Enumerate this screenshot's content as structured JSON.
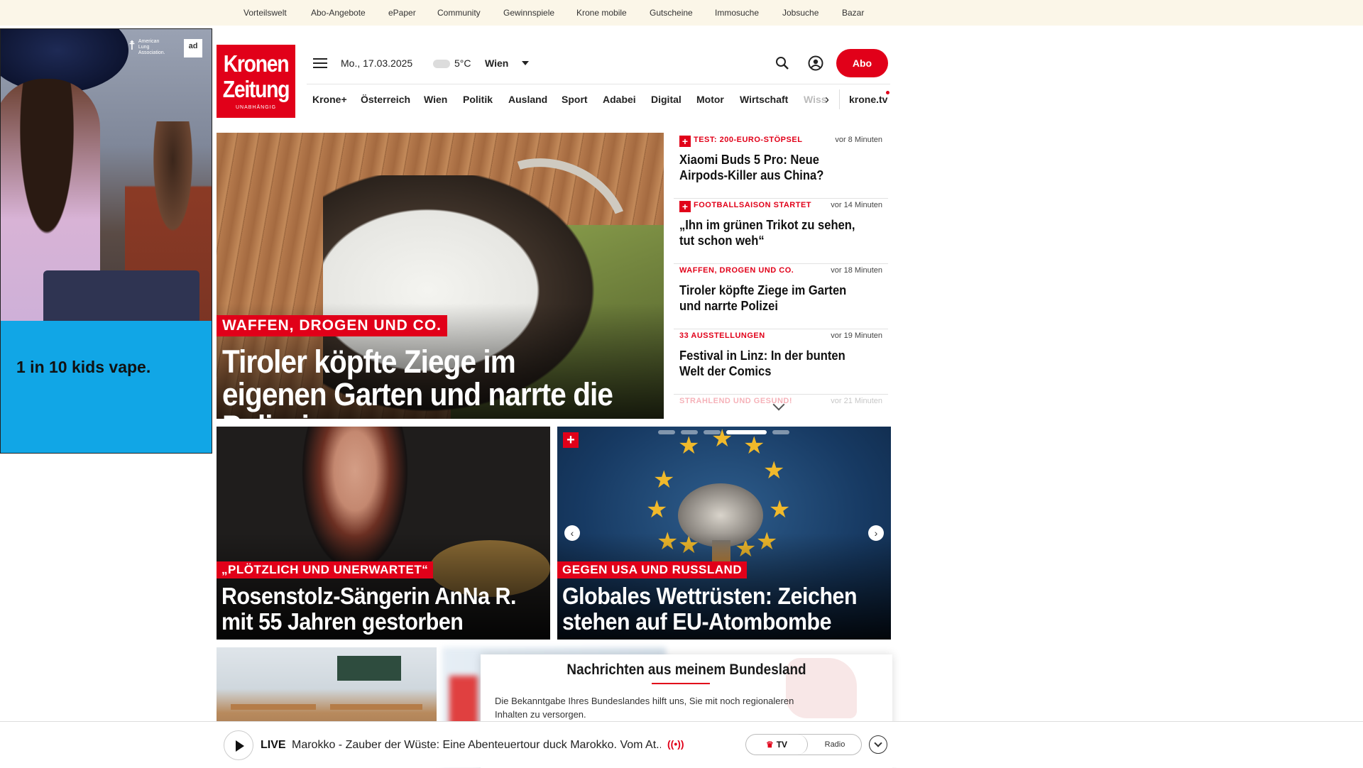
{
  "topbar": [
    "Vorteilswelt",
    "Abo-Angebote",
    "ePaper",
    "Community",
    "Gewinnspiele",
    "Krone mobile",
    "Gutscheine",
    "Immosuche",
    "Jobsuche",
    "Bazar"
  ],
  "ad": {
    "text": "1 in 10 kids vape.",
    "logo_text": "American Lung Association.",
    "badge": "ad"
  },
  "brand": {
    "line1": "Kronen",
    "line2": "Zeitung",
    "tagline": "UNABHÄNGIG"
  },
  "header": {
    "date": "Mo., 17.03.2025",
    "temperature": "5°C",
    "city": "Wien",
    "abo_label": "Abo",
    "icons": [
      "menu-icon",
      "cloud-icon",
      "search-icon",
      "user-icon"
    ]
  },
  "nav": {
    "items": [
      "Krone+",
      "Österreich",
      "Wien",
      "Politik",
      "Ausland",
      "Sport",
      "Adabei",
      "Digital",
      "Motor",
      "Wirtschaft",
      "Wiss"
    ],
    "tv": "krone.tv"
  },
  "hero": {
    "kicker": "WAFFEN, DROGEN UND CO.",
    "title": "Tiroler köpfte Ziege im eigenen Garten und narrte die Polizei"
  },
  "news": [
    {
      "plus": true,
      "category": "TEST: 200-EURO-STÖPSEL",
      "time": "vor 8 Minuten",
      "title": "Xiaomi Buds 5 Pro: Neue Airpods-Killer aus China?"
    },
    {
      "plus": true,
      "category": "FOOTBALLSAISON STARTET",
      "time": "vor 14 Minuten",
      "title": "„Ihn im grünen Trikot zu sehen, tut schon weh“"
    },
    {
      "plus": false,
      "category": "WAFFEN, DROGEN UND CO.",
      "time": "vor 18 Minuten",
      "title": "Tiroler köpfte Ziege im Garten und narrte Polizei"
    },
    {
      "plus": false,
      "category": "33 AUSSTELLUNGEN",
      "time": "vor 19 Minuten",
      "title": "Festival in Linz: In der bunten Welt der Comics"
    },
    {
      "plus": false,
      "category": "STRAHLEND UND GESUND!",
      "time": "vor 21 Minuten",
      "title": ""
    }
  ],
  "cards": [
    {
      "kicker": "„PLÖTZLICH UND UNERWARTET“",
      "title": "Rosenstolz-Sängerin AnNa R. mit 55 Jahren gestorben"
    },
    {
      "kicker": "GEGEN USA UND RUSSLAND",
      "title": "Globales Wettrüsten: Zeichen stehen auf EU-Atombombe",
      "plus": true
    }
  ],
  "carousel": {
    "slides": 6,
    "active": 3
  },
  "modal": {
    "heading": "Nachrichten aus meinem Bundesland",
    "text": "Die Bekanntgabe Ihres Bundeslandes hilft uns, Sie mit noch regionaleren Inhalten zu versorgen."
  },
  "player": {
    "live": "LIVE",
    "title": "Marokko - Zauber der Wüste: Eine Abenteuertour duck Marokko. Vom At...",
    "broadcast_icon": "((•))",
    "tv_label": "TV",
    "radio_label": "Radio"
  },
  "colors": {
    "brand_red": "#e10019",
    "topbar_bg": "#fbf6e8",
    "ad_blue": "#11a6e6"
  }
}
